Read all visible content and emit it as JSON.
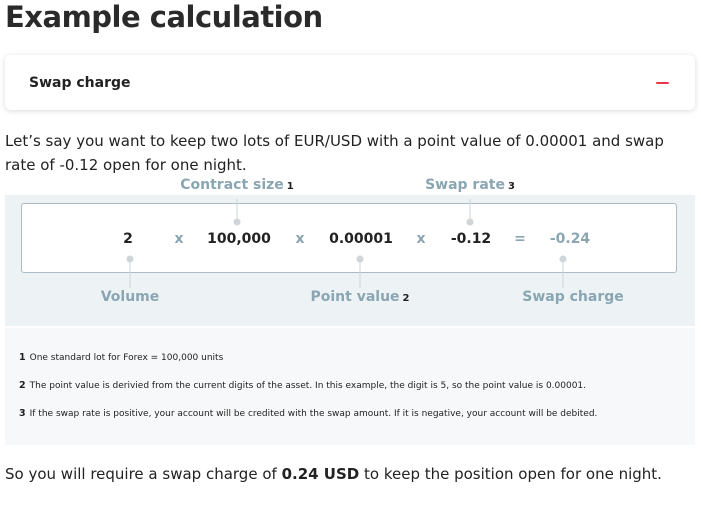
{
  "page": {
    "title": "Example calculation"
  },
  "accordion": {
    "label": "Swap charge",
    "icon": "minus-icon"
  },
  "intro": "Let’s say you want to keep two lots of EUR/USD with a point value of 0.00001 and swap rate of -0.12 open for one night.",
  "formula": {
    "terms": {
      "volume": "2",
      "contract_size": "100,000",
      "point_value": "0.00001",
      "swap_rate": "-0.12",
      "result": "-0.24"
    },
    "operators": {
      "multiply": "x",
      "equals": "="
    },
    "labels": {
      "contract_size": {
        "text": "Contract size",
        "ref": "1"
      },
      "swap_rate": {
        "text": "Swap rate",
        "ref": "3"
      },
      "volume": {
        "text": "Volume"
      },
      "point_value": {
        "text": "Point value",
        "ref": "2"
      },
      "swap_charge": {
        "text": "Swap charge"
      }
    }
  },
  "notes": [
    {
      "num": "1",
      "text": "One standard lot for Forex = 100,000 units"
    },
    {
      "num": "2",
      "text": "The point value is derivied from the current digits of the asset. In this example, the digit is 5, so the point value is 0.00001."
    },
    {
      "num": "3",
      "text": "If the swap rate is positive, your account will be credited with the swap amount. If it is negative, your account will be debited."
    }
  ],
  "outro": {
    "before": "So you will require a swap charge of ",
    "amount": "0.24 USD",
    "after": " to keep the position open for one night."
  },
  "colors": {
    "accent": "#e8394a",
    "label": "#8aa6b3",
    "panel": "#edf3f5",
    "notes_bg": "#f6f8f9"
  }
}
